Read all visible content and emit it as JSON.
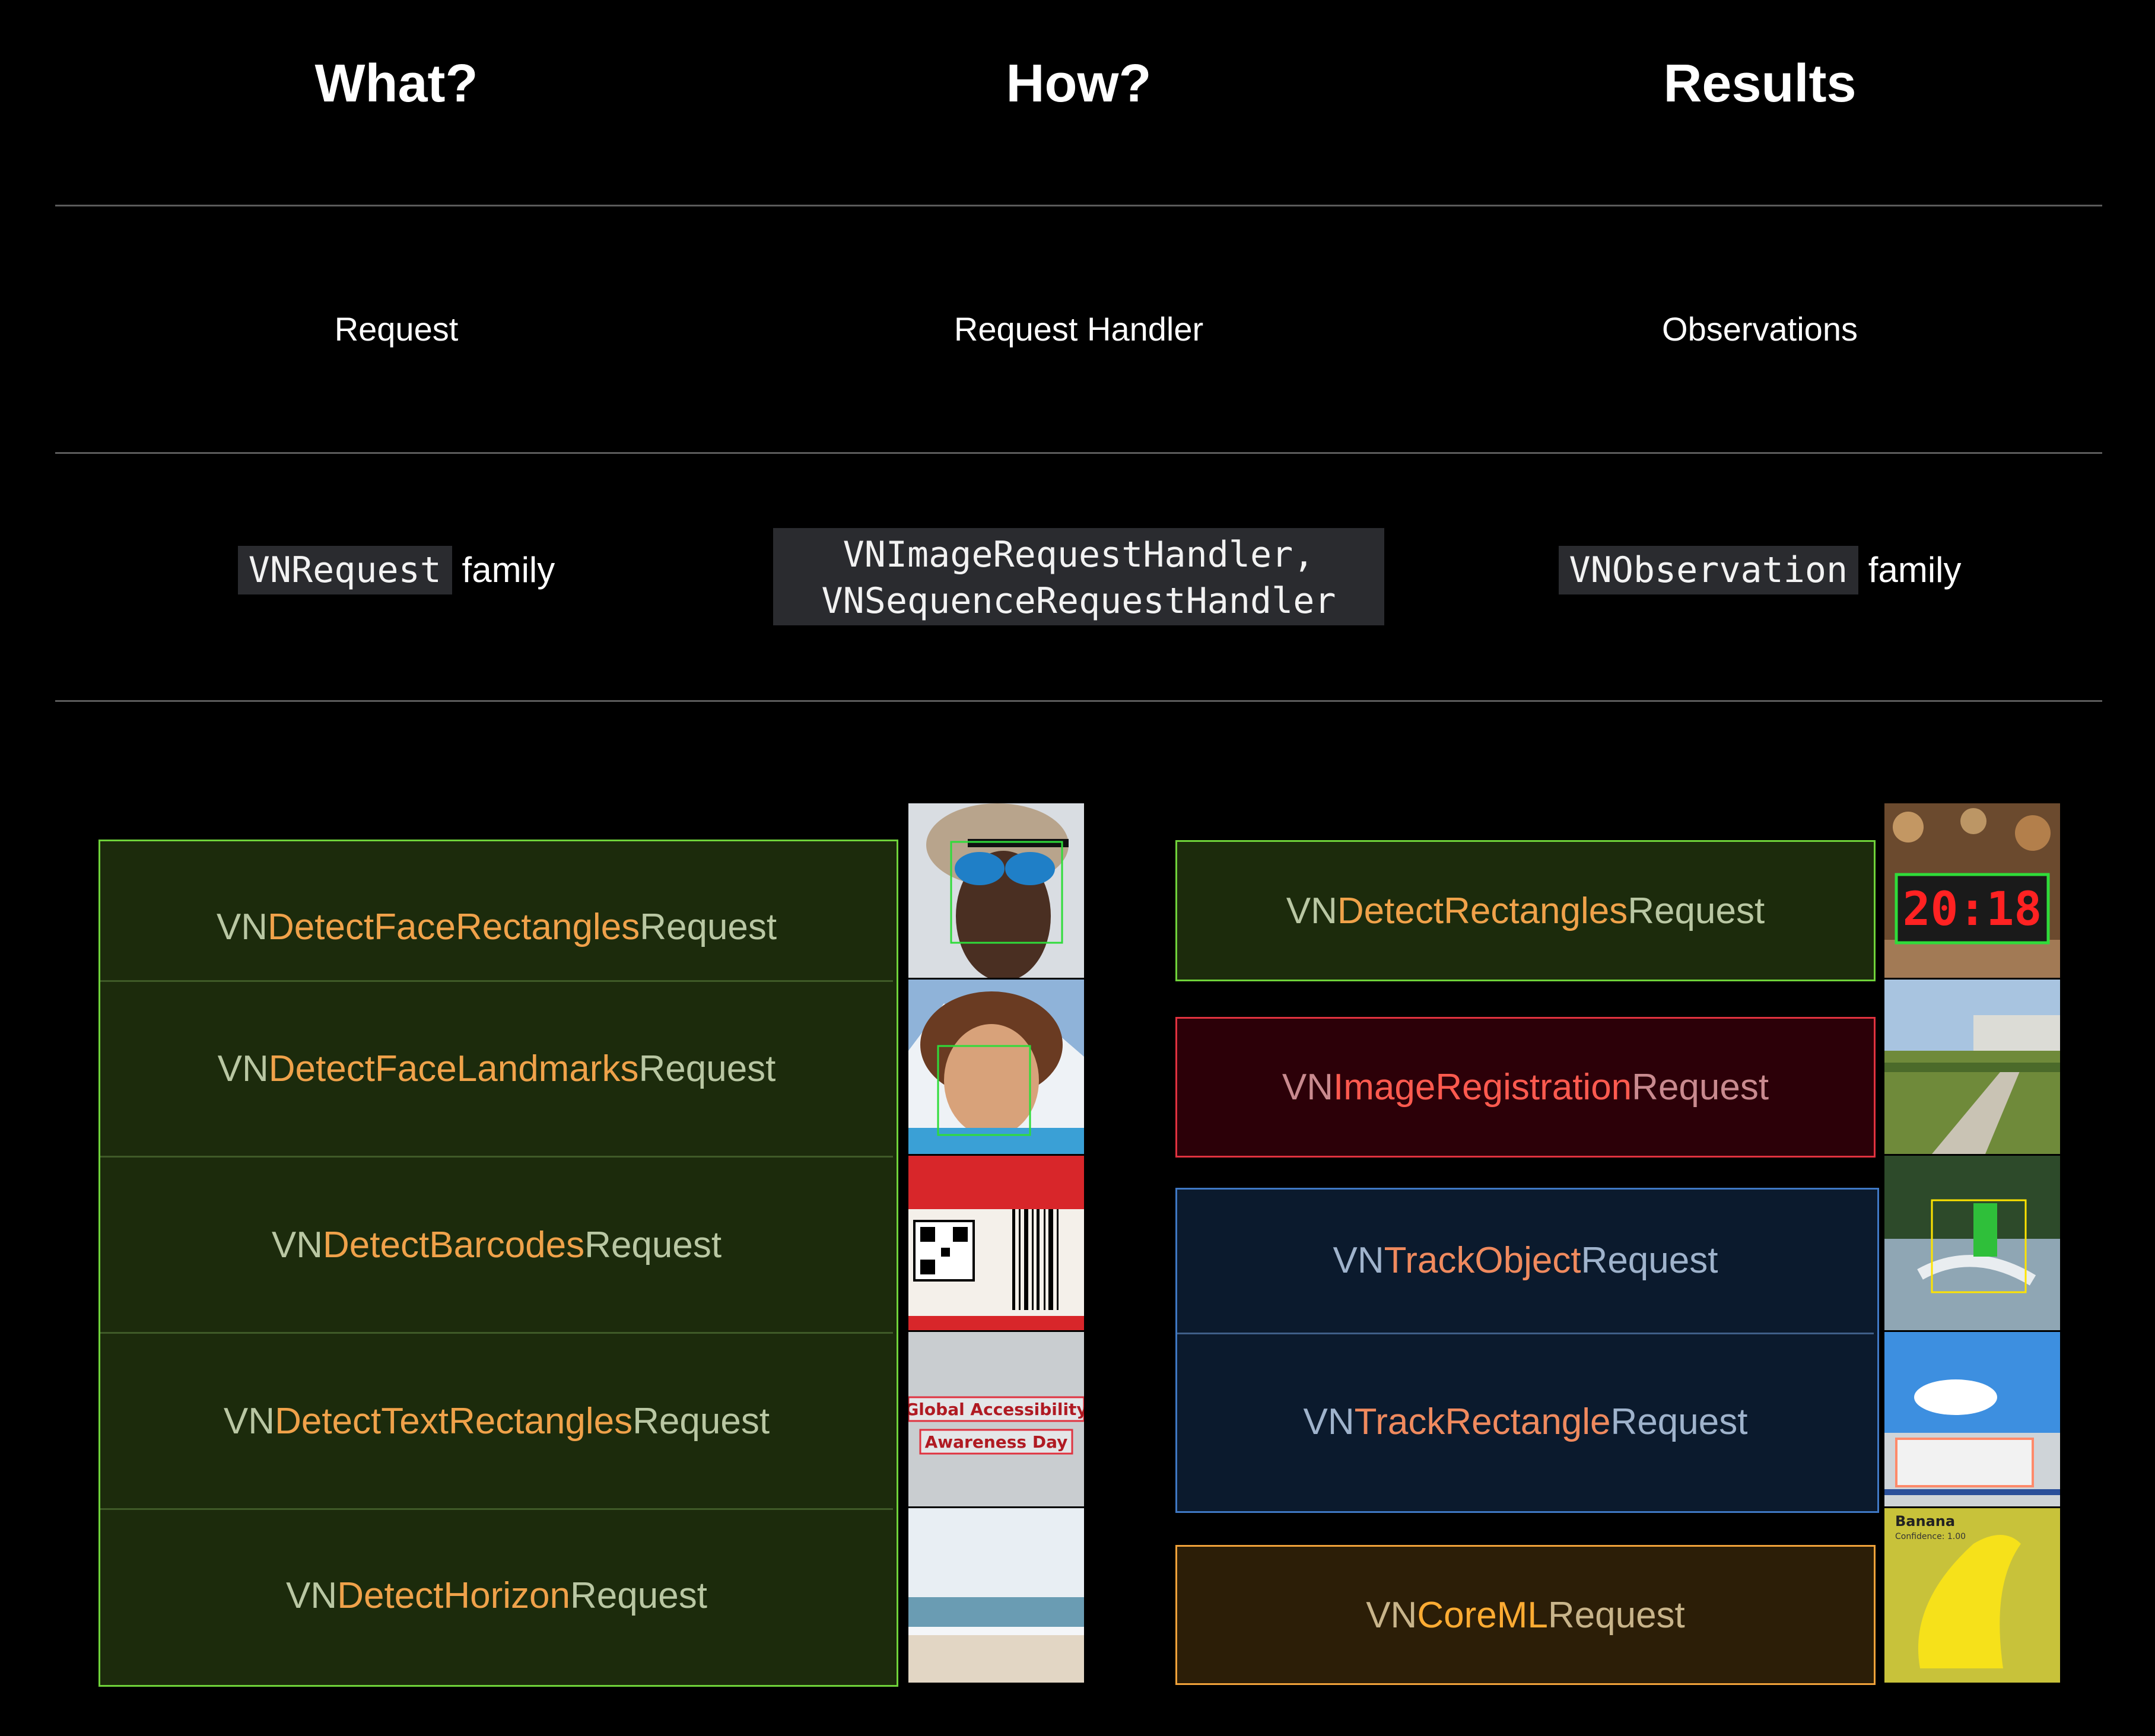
{
  "headers": {
    "what": "What?",
    "how": "How?",
    "results": "Results"
  },
  "row1": {
    "what": "Request",
    "how": "Request Handler",
    "results": "Observations"
  },
  "row2": {
    "what_code": "VNRequest",
    "what_suffix": "family",
    "how_line1": "VNImageRequestHandler,",
    "how_line2": "VNSequenceRequestHandler",
    "results_code": "VNObservation",
    "results_suffix": "family"
  },
  "left_requests": [
    {
      "prefix": "VN",
      "middle": "DetectFaceRectangles",
      "suffix": "Request",
      "image": "face-detection-thumbnail"
    },
    {
      "prefix": "VN",
      "middle": "DetectFaceLandmarks",
      "suffix": "Request",
      "image": "face-landmarks-thumbnail"
    },
    {
      "prefix": "VN",
      "middle": "DetectBarcodes",
      "suffix": "Request",
      "image": "barcode-thumbnail"
    },
    {
      "prefix": "VN",
      "middle": "DetectTextRectangles",
      "suffix": "Request",
      "image": "text-rectangles-thumbnail"
    },
    {
      "prefix": "VN",
      "middle": "DetectHorizon",
      "suffix": "Request",
      "image": "horizon-thumbnail"
    }
  ],
  "right_requests": [
    {
      "prefix": "VN",
      "middle": "DetectRectangles",
      "suffix": "Request",
      "image": "rectangle-clock-thumbnail"
    },
    {
      "prefix": "VN",
      "middle": "ImageRegistration",
      "suffix": "Request",
      "image": "registration-thumbnail"
    },
    {
      "prefix": "VN",
      "middle": "TrackObject",
      "suffix": "Request",
      "image": "track-object-thumbnail"
    },
    {
      "prefix": "VN",
      "middle": "TrackRectangle",
      "suffix": "Request",
      "image": "track-rectangle-thumbnail"
    },
    {
      "prefix": "VN",
      "middle": "CoreML",
      "suffix": "Request",
      "image": "coreml-banana-thumbnail"
    }
  ],
  "thumb_text": {
    "clock": "20:18",
    "text_line1": "Global Accessibility",
    "text_line2": "Awareness Day",
    "banana_label": "Banana",
    "banana_confidence": "Confidence: 1.00"
  },
  "colors": {
    "green_border": "#6fd23a",
    "red_border": "#e0323f",
    "blue_border": "#3f78c4",
    "orange_border": "#f0a23a",
    "highlight": "#f0a24a"
  }
}
